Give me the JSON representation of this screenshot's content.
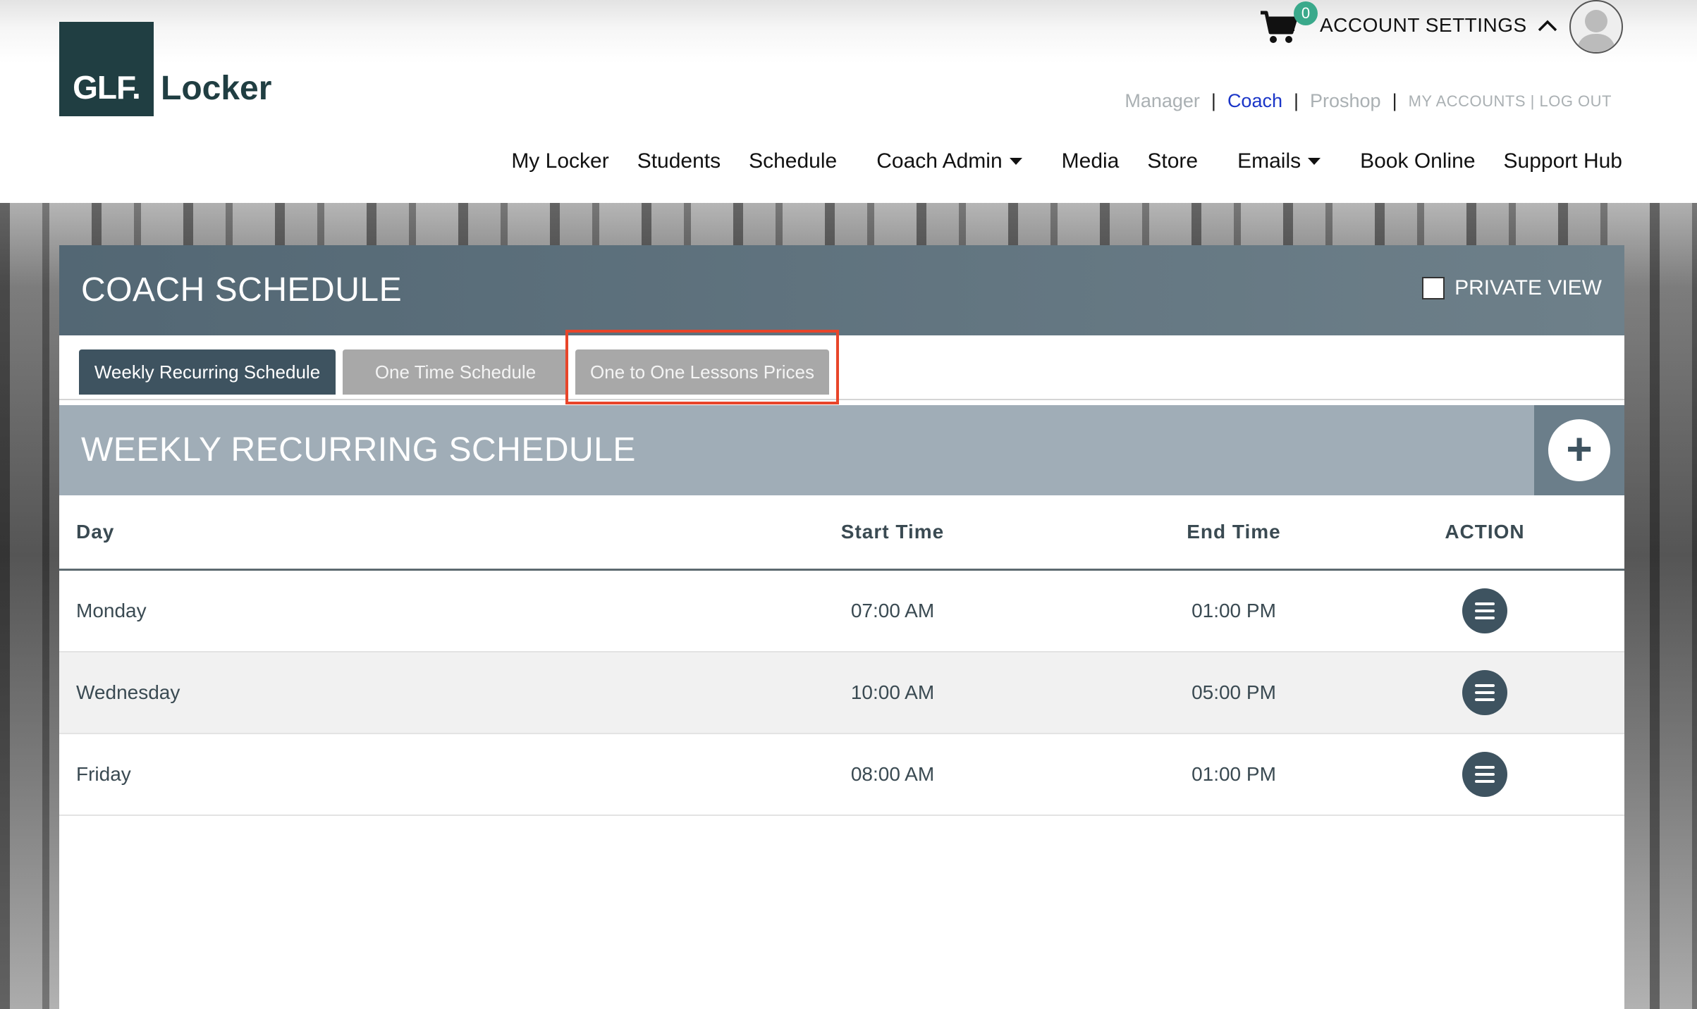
{
  "header": {
    "logo_mark": "GLF.",
    "logo_word": "Locker",
    "cart_count": "0",
    "account_settings": "ACCOUNT SETTINGS",
    "roles": [
      "Manager",
      "Coach",
      "Proshop"
    ],
    "active_role": "Coach",
    "account_links": "MY ACCOUNTS | LOG OUT"
  },
  "nav": {
    "items": [
      {
        "label": "My Locker"
      },
      {
        "label": "Students"
      },
      {
        "label": "Schedule"
      },
      {
        "label": "Coach Admin",
        "dropdown": true
      },
      {
        "label": "Media"
      },
      {
        "label": "Store"
      },
      {
        "label": "Emails",
        "dropdown": true
      },
      {
        "label": "Book Online"
      },
      {
        "label": "Support Hub"
      }
    ]
  },
  "panel": {
    "title": "COACH SCHEDULE",
    "private_view": "PRIVATE VIEW",
    "tabs": [
      {
        "label": "Weekly Recurring Schedule",
        "active": true
      },
      {
        "label": "One Time Schedule",
        "active": false
      },
      {
        "label": "One to One Lessons Prices",
        "active": false,
        "highlighted": true
      }
    ],
    "section_title": "WEEKLY RECURRING SCHEDULE",
    "add_label": "+"
  },
  "table": {
    "headers": {
      "day": "Day",
      "start": "Start Time",
      "end": "End Time",
      "action": "ACTION"
    },
    "rows": [
      {
        "day": "Monday",
        "start": "07:00 AM",
        "end": "01:00 PM"
      },
      {
        "day": "Wednesday",
        "start": "10:00 AM",
        "end": "05:00 PM"
      },
      {
        "day": "Friday",
        "start": "08:00 AM",
        "end": "01:00 PM"
      }
    ]
  },
  "colors": {
    "brand": "#203e42",
    "active_role": "#1a35c8",
    "cart_badge": "#3aa98b",
    "tab_active": "#3e5360",
    "tab_inactive": "#a8a8a8",
    "highlight_box": "#e8452a"
  }
}
